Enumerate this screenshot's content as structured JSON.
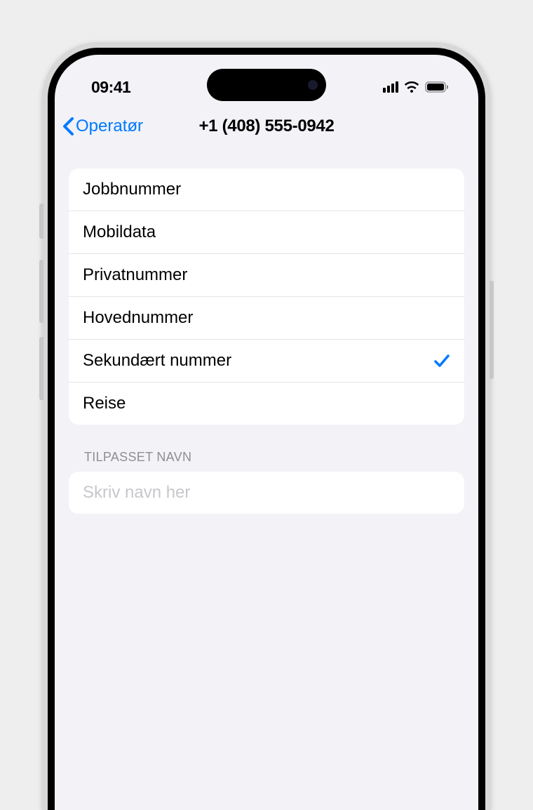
{
  "status_bar": {
    "time": "09:41"
  },
  "nav": {
    "back_label": "Operatør",
    "title": "+1 (408) 555-0942"
  },
  "labels": {
    "items": [
      {
        "text": "Jobbnummer",
        "selected": false
      },
      {
        "text": "Mobildata",
        "selected": false
      },
      {
        "text": "Privatnummer",
        "selected": false
      },
      {
        "text": "Hovednummer",
        "selected": false
      },
      {
        "text": "Sekundært nummer",
        "selected": true
      },
      {
        "text": "Reise",
        "selected": false
      }
    ]
  },
  "custom_name": {
    "header": "Tilpasset navn",
    "placeholder": "Skriv navn her"
  }
}
